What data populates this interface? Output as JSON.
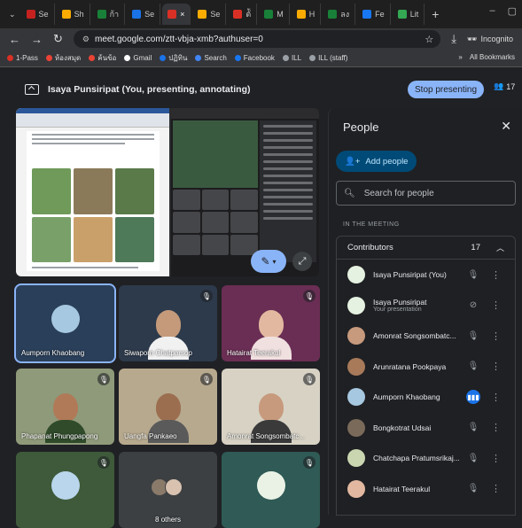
{
  "browser": {
    "tabs": [
      {
        "label": "Se",
        "color": "#c5221f"
      },
      {
        "label": "Sh",
        "color": "#f9ab00"
      },
      {
        "label": "ก้า",
        "color": "#188038"
      },
      {
        "label": "Se",
        "color": "#1a73e8"
      },
      {
        "label": "×",
        "color": "#d93025",
        "active": true
      },
      {
        "label": "Se",
        "color": "#f9ab00"
      },
      {
        "label": "ต้ั",
        "color": "#d93025"
      },
      {
        "label": "M",
        "color": "#188038"
      },
      {
        "label": "H",
        "color": "#f9ab00"
      },
      {
        "label": "ลง",
        "color": "#188038"
      },
      {
        "label": "Fe",
        "color": "#1877f2"
      },
      {
        "label": "Lit",
        "color": "#34a853"
      }
    ],
    "new_tab": "+",
    "url": "meet.google.com/ztt-vbja-xmb?authuser=0",
    "incognito_label": "Incognito",
    "bookmarks": [
      {
        "label": "1-Pass",
        "color": "#d93025"
      },
      {
        "label": "ห้องสมุด",
        "color": "#ea4335"
      },
      {
        "label": "ค้นข้อ",
        "color": "#ea4335"
      },
      {
        "label": "Gmail",
        "color": "#ffffff"
      },
      {
        "label": "ปฏิทิน",
        "color": "#1a73e8"
      },
      {
        "label": "Search",
        "color": "#4285f4"
      },
      {
        "label": "Facebook",
        "color": "#1877f2"
      },
      {
        "label": "ILL",
        "color": "#9aa0a6"
      },
      {
        "label": "ILL (staff)",
        "color": "#9aa0a6"
      }
    ],
    "bookmarks_more": "»",
    "all_bookmarks": "All Bookmarks"
  },
  "meet": {
    "presenting_title": "Isaya Punsiripat (You, presenting, annotating)",
    "stop_presenting": "Stop presenting",
    "participant_count": "17",
    "tiles": [
      {
        "name": "Aumporn Khaobang",
        "kind": "avatar",
        "bg": "#2a3f5a",
        "avatar": "#a6c8e0",
        "highlight": true
      },
      {
        "name": "Siwaporn Chatparsop",
        "kind": "face",
        "bg": "#2d3a4c",
        "skin": "#c49a7a",
        "body": "#f1f1f1",
        "muted": true
      },
      {
        "name": "Hatairat Teerakul",
        "kind": "face",
        "bg": "#6a2e54",
        "skin": "#e2b9a0",
        "body": "#f0e0e0",
        "muted": true
      },
      {
        "name": "Phapanat Phungpapong",
        "kind": "face",
        "bg": "#8f9a7a",
        "skin": "#b07a58",
        "body": "#2f4b2a",
        "muted": true
      },
      {
        "name": "Uangfa Pankaeo",
        "kind": "face",
        "bg": "#b7a98e",
        "skin": "#9c6e50",
        "body": "#5a5a5a",
        "muted": true
      },
      {
        "name": "Amonrat Songsombatc...",
        "kind": "face",
        "bg": "#d7d2c4",
        "skin": "#c79a7d",
        "body": "#3a3a3a",
        "muted": true
      },
      {
        "name": "",
        "kind": "avatar",
        "bg": "#3e5a3a",
        "avatar": "#b9d6ec",
        "muted": true
      },
      {
        "name": "8 others",
        "kind": "others",
        "bg": "#3c4043"
      },
      {
        "name": "",
        "kind": "avatar",
        "bg": "#2f5a55",
        "avatar": "#eaf2e6",
        "muted": true
      }
    ],
    "annotate_icon": "pen-icon"
  },
  "people_panel": {
    "title": "People",
    "add_people": "Add people",
    "search_placeholder": "Search for people",
    "in_meeting": "IN THE MEETING",
    "contributors_label": "Contributors",
    "contributors_count": "17",
    "people": [
      {
        "name": "Isaya Punsiripat (You)",
        "sub": "",
        "avatar": "#e6f2e1",
        "mic": "muted"
      },
      {
        "name": "Isaya Punsiripat",
        "sub": "Your presentation",
        "avatar": "#e6f2e1",
        "mic": "present"
      },
      {
        "name": "Amonrat Songsombatc...",
        "sub": "",
        "avatar": "#c79a7d",
        "mic": "muted"
      },
      {
        "name": "Arunratana Pookpaya",
        "sub": "",
        "avatar": "#a87a5a",
        "mic": "muted"
      },
      {
        "name": "Aumporn Khaobang",
        "sub": "",
        "avatar": "#a6c8e0",
        "mic": "active"
      },
      {
        "name": "Bongkotrat Udsai",
        "sub": "",
        "avatar": "#7a6a5a",
        "mic": "muted"
      },
      {
        "name": "Chatchapa Pratumsrikaj...",
        "sub": "",
        "avatar": "#c9d6b0",
        "mic": "muted"
      },
      {
        "name": "Hatairat Teerakul",
        "sub": "",
        "avatar": "#e2b9a0",
        "mic": "muted"
      }
    ]
  }
}
